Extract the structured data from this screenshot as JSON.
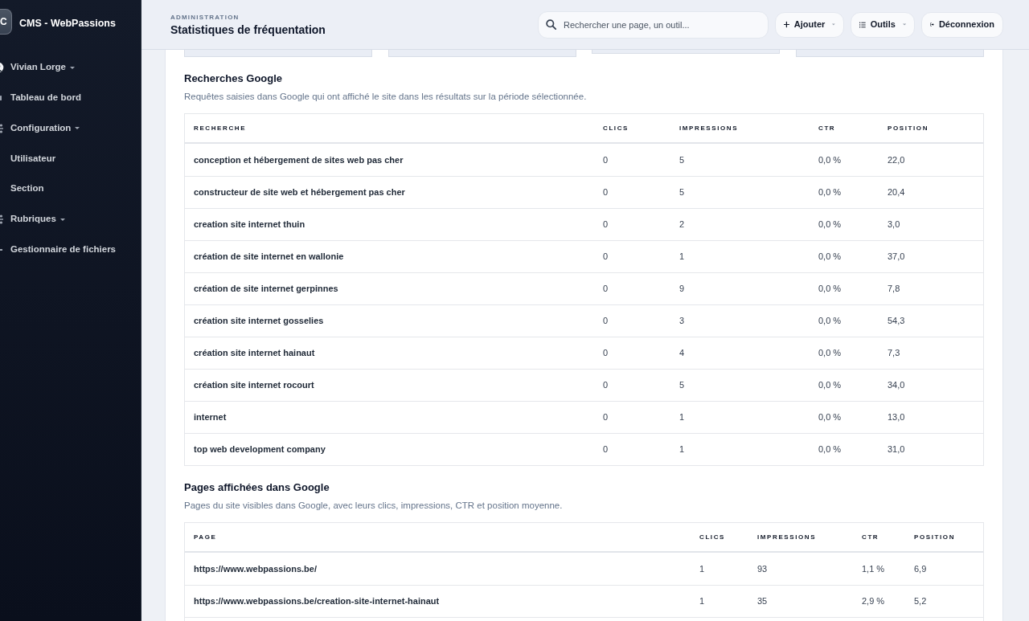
{
  "sidebar": {
    "logo": {
      "letter": "C",
      "title": "CMS - WebPassions"
    },
    "items": [
      {
        "label": "Vivian Lorge",
        "has_menu": true
      },
      {
        "label": "Tableau de bord",
        "has_menu": false
      },
      {
        "label": "Configuration",
        "has_menu": true,
        "children": [
          {
            "label": "Utilisateur"
          },
          {
            "label": "Section"
          }
        ]
      },
      {
        "label": "Rubriques",
        "has_menu": true
      },
      {
        "label": "Gestionnaire de fichiers",
        "has_menu": false
      }
    ]
  },
  "header": {
    "eyebrow": "ADMINISTRATION",
    "title": "Statistiques de fréquentation",
    "search": {
      "placeholder": "Rechercher une page, un outil..."
    },
    "buttons": [
      {
        "label": "Ajouter",
        "has_menu": true
      },
      {
        "label": "Outils",
        "has_menu": true
      },
      {
        "label": "Déconnexion",
        "has_menu": false
      }
    ]
  },
  "tabs": [
    {
      "selected": false
    },
    {
      "selected": false
    },
    {
      "selected": true
    },
    {
      "selected": false
    }
  ],
  "sections": [
    {
      "title": "Recherches Google",
      "description": "Requêtes saisies dans Google qui ont affiché le site dans les résultats sur la période sélectionnée.",
      "table": {
        "columns": [
          "RECHERCHE",
          "CLICS",
          "IMPRESSIONS",
          "CTR",
          "POSITION"
        ],
        "rows": [
          [
            "conception et hébergement de sites web pas cher",
            "0",
            "5",
            "0,0 %",
            "22,0"
          ],
          [
            "constructeur de site web et hébergement pas cher",
            "0",
            "5",
            "0,0 %",
            "20,4"
          ],
          [
            "creation site internet thuin",
            "0",
            "2",
            "0,0 %",
            "3,0"
          ],
          [
            "création de site internet en wallonie",
            "0",
            "1",
            "0,0 %",
            "37,0"
          ],
          [
            "création de site internet gerpinnes",
            "0",
            "9",
            "0,0 %",
            "7,8"
          ],
          [
            "création site internet gosselies",
            "0",
            "3",
            "0,0 %",
            "54,3"
          ],
          [
            "création site internet hainaut",
            "0",
            "4",
            "0,0 %",
            "7,3"
          ],
          [
            "création site internet rocourt",
            "0",
            "5",
            "0,0 %",
            "34,0"
          ],
          [
            "internet",
            "0",
            "1",
            "0,0 %",
            "13,0"
          ],
          [
            "top web development company",
            "0",
            "1",
            "0,0 %",
            "31,0"
          ]
        ]
      }
    },
    {
      "title": "Pages affichées dans Google",
      "description": "Pages du site visibles dans Google, avec leurs clics, impressions, CTR et position moyenne.",
      "table": {
        "columns": [
          "PAGE",
          "CLICS",
          "IMPRESSIONS",
          "CTR",
          "POSITION"
        ],
        "rows": [
          [
            "https://www.webpassions.be/",
            "1",
            "93",
            "1,1 %",
            "6,9"
          ],
          [
            "https://www.webpassions.be/creation-site-internet-hainaut",
            "1",
            "35",
            "2,9 %",
            "5,2"
          ]
        ]
      }
    }
  ]
}
